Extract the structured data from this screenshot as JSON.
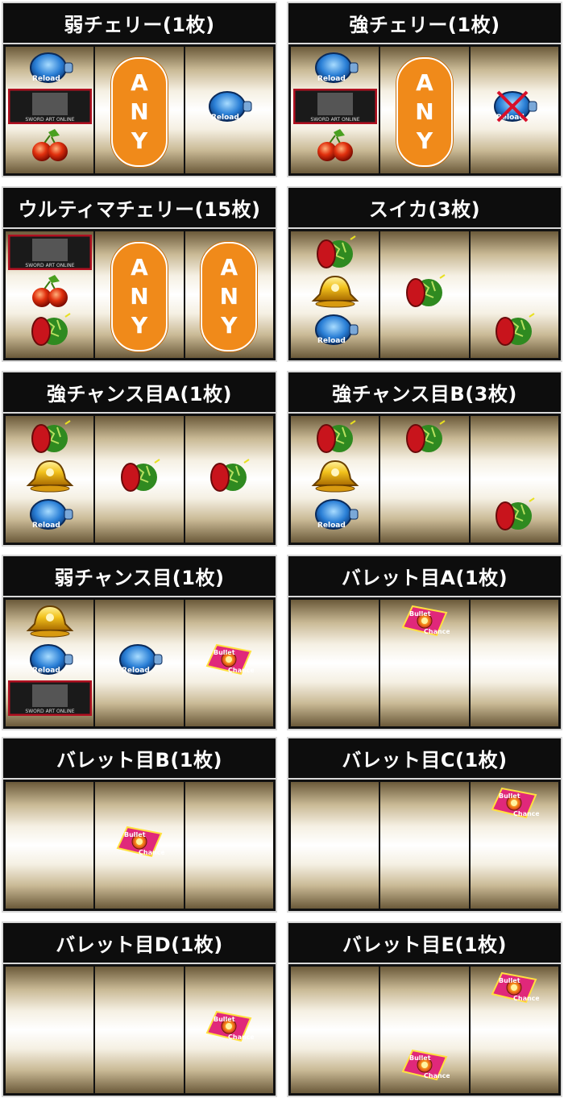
{
  "any_text": [
    "A",
    "N",
    "Y"
  ],
  "panels": [
    {
      "title": "弱チェリー(1枚)"
    },
    {
      "title": "強チェリー(1枚)"
    },
    {
      "title": "ウルティマチェリー(15枚)"
    },
    {
      "title": "スイカ(3枚)"
    },
    {
      "title": "強チャンス目A(1枚)"
    },
    {
      "title": "強チャンス目B(3枚)"
    },
    {
      "title": "弱チャンス目(1枚)"
    },
    {
      "title": "バレット目A(1枚)"
    },
    {
      "title": "バレット目B(1枚)"
    },
    {
      "title": "バレット目C(1枚)"
    },
    {
      "title": "バレット目D(1枚)"
    },
    {
      "title": "バレット目E(1枚)"
    }
  ],
  "symbols": {
    "reload": {
      "label": "Reload",
      "color": "#2a7fd6"
    },
    "sao": {
      "label": "SWORD ART ONLINE",
      "color": "#b01020"
    },
    "bullet": {
      "line1": "Bullet",
      "line2": "Chance",
      "color": "#e0287a"
    }
  },
  "colors": {
    "any_orange": "#f08a1a",
    "header_bg": "#0d0d0d"
  }
}
